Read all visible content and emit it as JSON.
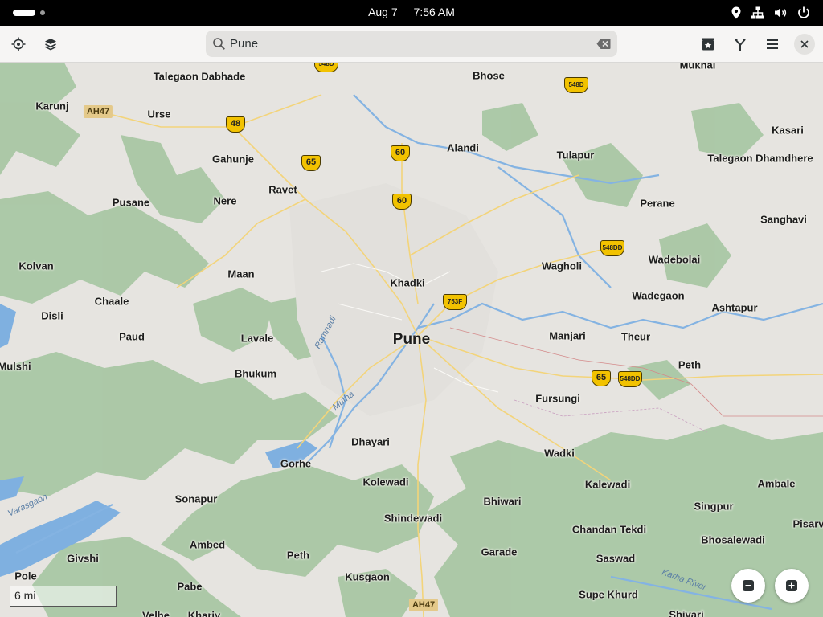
{
  "topbar": {
    "date": "Aug 7",
    "time": "7:56 AM",
    "icons": [
      "location-icon",
      "network-icon",
      "volume-icon",
      "power-icon"
    ]
  },
  "header": {
    "search": {
      "value": "Pune",
      "placeholder": "Search"
    },
    "icons": [
      "locate-icon",
      "layers-icon",
      "favorites-icon",
      "route-icon",
      "menu-icon",
      "close-icon"
    ]
  },
  "map": {
    "city": "Pune",
    "places": [
      "Talegaon Dabhade",
      "Bhose",
      "Mukhai",
      "Karunj",
      "Urse",
      "Kasari",
      "Alandi",
      "Tulapur",
      "Gahunje",
      "Talegaon Dhamdhere",
      "Ravet",
      "Pusane",
      "Nere",
      "Perane",
      "Sanghavi",
      "Kolvan",
      "Maan",
      "Wagholi",
      "Wadebolai",
      "Khadki",
      "Chaale",
      "Wadegaon",
      "Ashtapur",
      "Disli",
      "Manjari",
      "Paud",
      "Lavale",
      "Theur",
      "Mulshi",
      "Bhukum",
      "Peth",
      "Fursungi",
      "Dhayari",
      "Gorhe",
      "Wadki",
      "Kolewadi",
      "Kalewadi",
      "Ambale",
      "Sonapur",
      "Bhiwari",
      "Singpur",
      "Shindewadi",
      "Pisarv",
      "Chandan Tekdi",
      "Ambed",
      "Garade",
      "Bhosalewadi",
      "Givshi",
      "Peth",
      "Saswad",
      "Pole",
      "Kusgaon",
      "Pabe",
      "Supe Khurd",
      "Velhe",
      "Khariy",
      "Shivari"
    ],
    "shields": [
      "548D",
      "548D",
      "48",
      "65",
      "60",
      "60",
      "548DD",
      "753F",
      "65",
      "548DD"
    ],
    "asian_highways": [
      "AH47",
      "AH47"
    ],
    "rivers": [
      "Ramnadi",
      "Mutha",
      "Varasgaon",
      "Karha River"
    ],
    "scale": "6 mi"
  },
  "controls": {
    "zoom_out": "zoom-out-icon",
    "zoom_in": "zoom-in-icon"
  }
}
